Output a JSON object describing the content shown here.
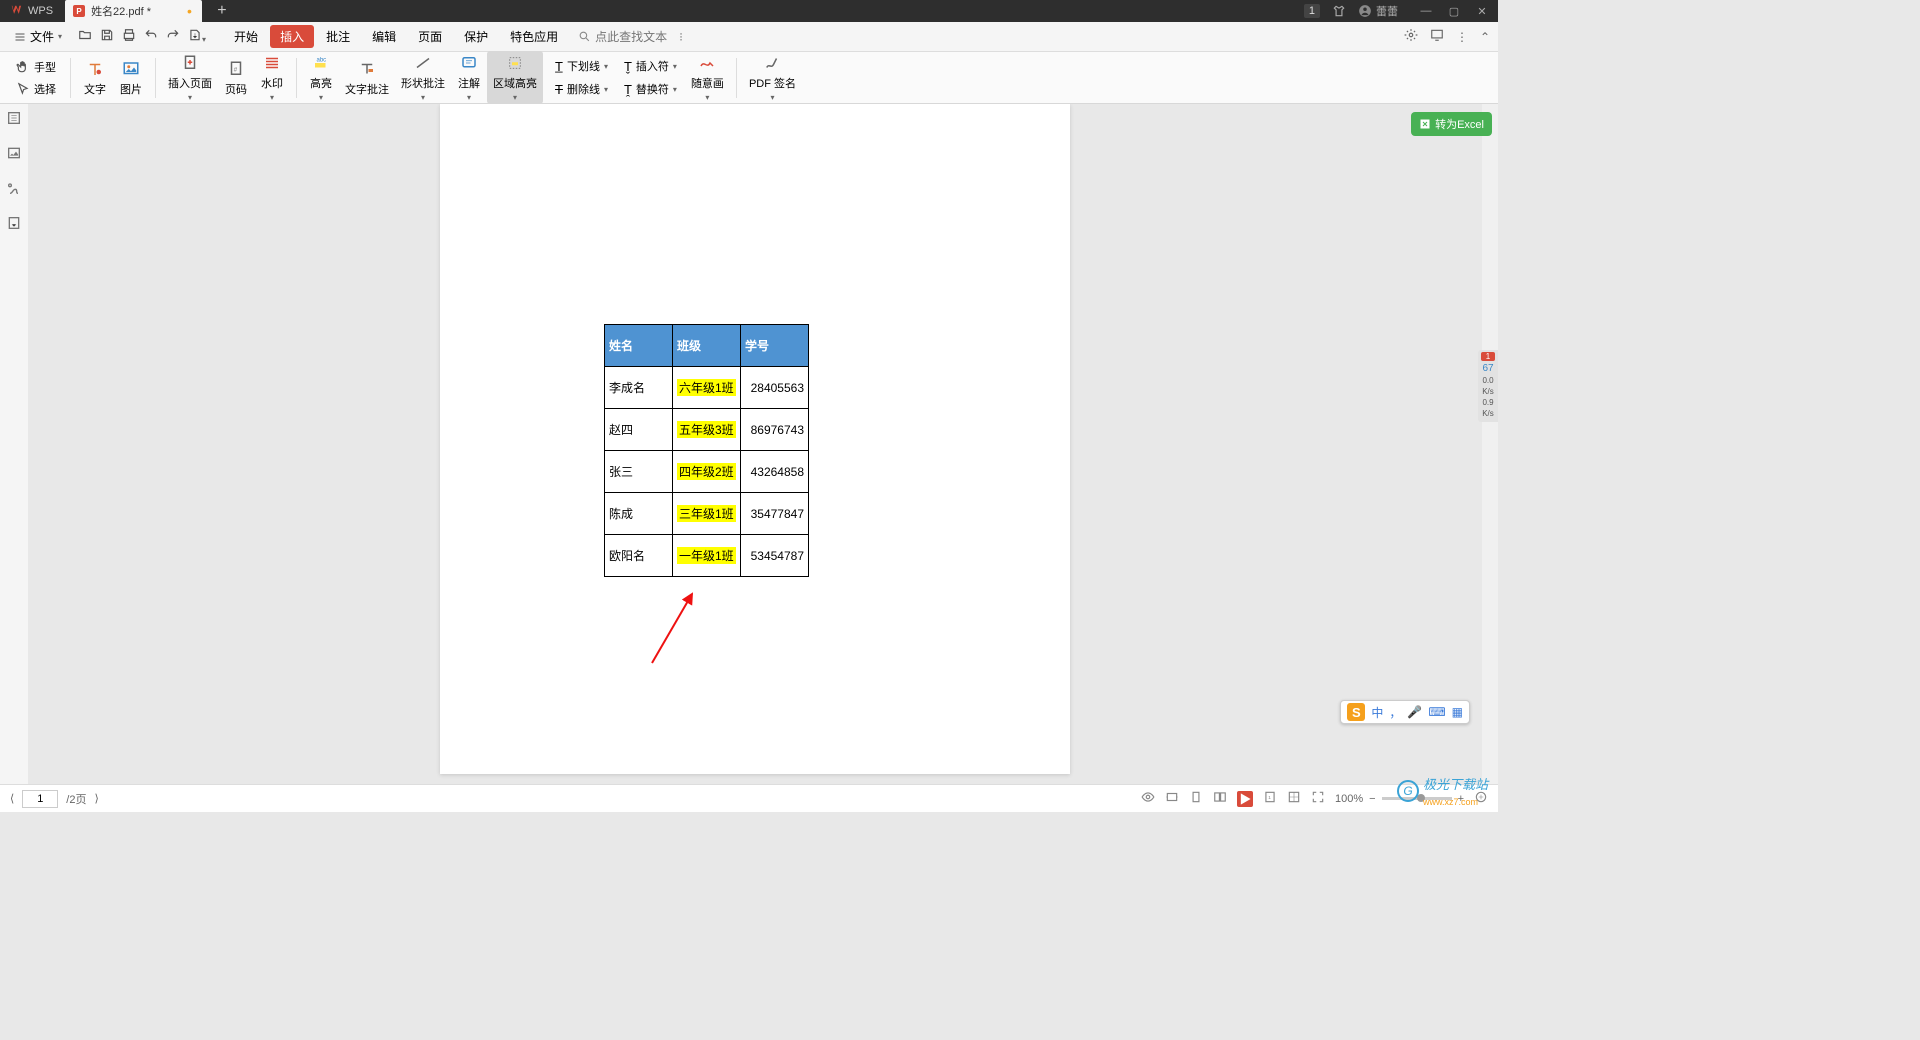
{
  "app": {
    "name": "WPS",
    "tab_title": "姓名22.pdf *",
    "user": "蕾蕾"
  },
  "menubar": {
    "file": "文件",
    "tabs": [
      "开始",
      "插入",
      "批注",
      "编辑",
      "页面",
      "保护",
      "特色应用"
    ],
    "active_index": 1,
    "search_placeholder": "点此查找文本",
    "search_suffix": "⁝"
  },
  "ribbon": {
    "left_small": {
      "hand": "手型",
      "select": "选择"
    },
    "items": {
      "text": "文字",
      "image": "图片",
      "insert_page": "插入页面",
      "page_num": "页码",
      "watermark": "水印",
      "highlight": "高亮",
      "text_annot": "文字批注",
      "shape_annot": "形状批注",
      "annot": "注解",
      "area_hl": "区域高亮"
    },
    "small": {
      "underline": "下划线",
      "insert_char": "插入符",
      "strike": "删除线",
      "replace": "替换符"
    },
    "items2": {
      "freedraw": "随意画",
      "pdf_sign": "PDF 签名"
    }
  },
  "right": {
    "to_excel": "转为Excel"
  },
  "meter": {
    "badge": "1",
    "pct": "67",
    "r1": "0.0",
    "u1": "K/s",
    "r2": "0.9",
    "u2": "K/s"
  },
  "page": {
    "headers": [
      "姓名",
      "班级",
      "学号"
    ],
    "rows": [
      {
        "name": "李成名",
        "class": "六年级1班",
        "id": "28405563"
      },
      {
        "name": "赵四",
        "class": "五年级3班",
        "id": "86976743"
      },
      {
        "name": "张三",
        "class": "四年级2班",
        "id": "43264858"
      },
      {
        "name": "陈成",
        "class": "三年级1班",
        "id": "35477847"
      },
      {
        "name": "欧阳名",
        "class": "一年级1班",
        "id": "53454787"
      }
    ]
  },
  "status": {
    "page_current": "1",
    "page_total": "/2页",
    "zoom": "100%"
  },
  "ime": {
    "lang": "中",
    "punct": "，",
    "kbd": "⌨",
    "grid": "▦"
  },
  "watermark": {
    "brand": "极光下载站",
    "url": "www.xz7.com"
  }
}
